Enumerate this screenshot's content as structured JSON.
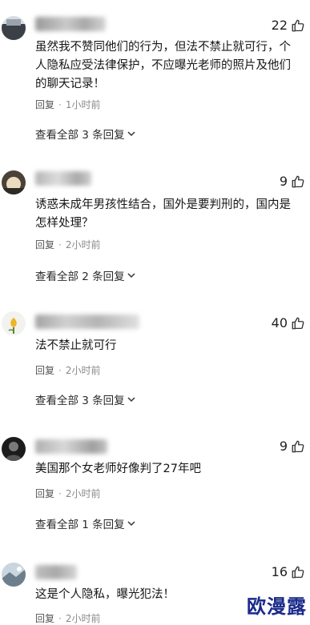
{
  "comments": [
    {
      "likes": "22",
      "text": "虽然我不赞同他们的行为，但法不禁止就可行，个人隐私应受法律保护，不应曝光老师的照片及他们的聊天记录！",
      "reply_label": "回复",
      "separator": "·",
      "time": "1小时前",
      "view_replies": "查看全部 3 条回复"
    },
    {
      "likes": "9",
      "text": "诱惑未成年男孩性结合，国外是要判刑的，国内是怎样处理？",
      "reply_label": "回复",
      "separator": "·",
      "time": "2小时前",
      "view_replies": "查看全部 2 条回复"
    },
    {
      "likes": "40",
      "text": "法不禁止就可行",
      "reply_label": "回复",
      "separator": "·",
      "time": "2小时前",
      "view_replies": "查看全部 3 条回复"
    },
    {
      "likes": "9",
      "text": "美国那个女老师好像判了27年吧",
      "reply_label": "回复",
      "separator": "·",
      "time": "2小时前",
      "view_replies": "查看全部 1 条回复"
    },
    {
      "likes": "16",
      "text": "这是个人隐私，曝光犯法！",
      "reply_label": "回复",
      "separator": "·",
      "time": "2小时前"
    }
  ],
  "watermark": "欧漫露",
  "icons": {
    "like": "thumbs-up-icon",
    "chevron": "chevron-down-icon"
  },
  "colors": {
    "text": "#161616",
    "meta": "#8a8a8a",
    "watermark": "#1a2a8a"
  }
}
